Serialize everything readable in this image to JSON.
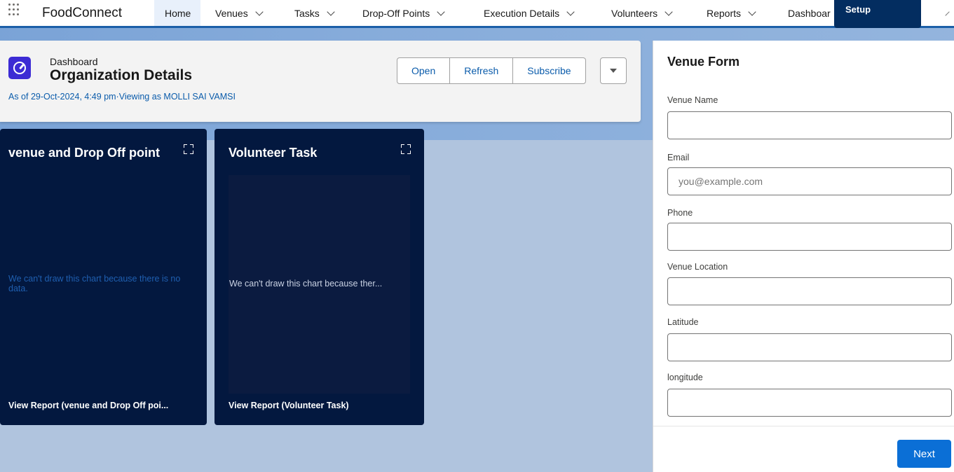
{
  "app": {
    "name": "FoodConnect"
  },
  "nav": {
    "items": [
      {
        "label": "Home",
        "active": true,
        "dropdown": false
      },
      {
        "label": "Venues",
        "dropdown": true
      },
      {
        "label": "Tasks",
        "dropdown": true
      },
      {
        "label": "Drop-Off Points",
        "dropdown": true
      },
      {
        "label": "Execution Details",
        "dropdown": true
      },
      {
        "label": "Volunteers",
        "dropdown": true
      },
      {
        "label": "Reports",
        "dropdown": true
      },
      {
        "label": "Dashboar",
        "dropdown": false
      }
    ],
    "setup_label": "Setup"
  },
  "header": {
    "breadcrumb": "Dashboard",
    "title": "Organization Details",
    "as_of": "As of 29-Oct-2024, 4:49 pm·Viewing as MOLLI SAI VAMSI",
    "buttons": {
      "open": "Open",
      "refresh": "Refresh",
      "subscribe": "Subscribe"
    }
  },
  "cards": [
    {
      "title": "venue and Drop Off point",
      "message": "We can't draw this chart because there is no data.",
      "footer": "View Report (venue and Drop Off poi..."
    },
    {
      "title": "Volunteer Task",
      "message": "We can't draw this chart because ther...",
      "footer": "View Report (Volunteer Task)"
    }
  ],
  "form": {
    "title": "Venue Form",
    "fields": [
      {
        "label": "Venue Name",
        "value": "",
        "placeholder": ""
      },
      {
        "label": "Email",
        "value": "",
        "placeholder": "you@example.com"
      },
      {
        "label": "Phone",
        "value": "",
        "placeholder": ""
      },
      {
        "label": "Venue Location",
        "value": "",
        "placeholder": ""
      },
      {
        "label": "Latitude",
        "value": "",
        "placeholder": ""
      },
      {
        "label": "longitude",
        "value": "",
        "placeholder": ""
      }
    ],
    "next_label": "Next"
  },
  "colors": {
    "accent": "#0b5cab",
    "nav_border": "#1b5fa8",
    "card_bg": "#03183f",
    "dashboard_icon": "#3c2bd4",
    "next_button": "#0b6fd6",
    "setup_bg": "#032d60",
    "no_data_text_1": "#1f5fb0",
    "no_data_text_2": "#c9d2e3"
  },
  "icons": [
    "app-launcher-icon",
    "dashboard-icon",
    "chevron-down-icon",
    "expand-icon",
    "dropdown-arrow-icon"
  ]
}
